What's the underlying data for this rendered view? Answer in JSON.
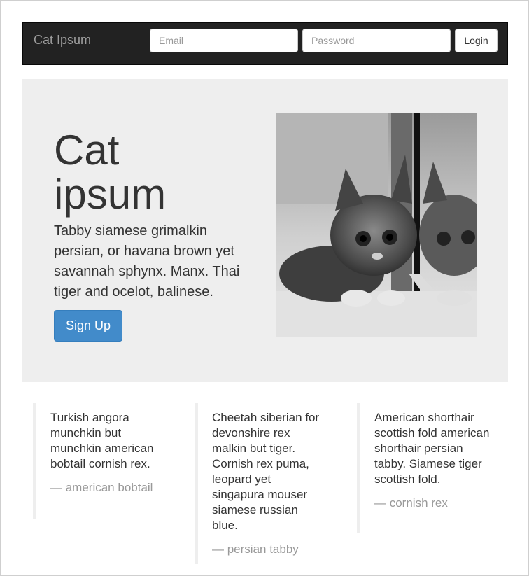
{
  "navbar": {
    "brand": "Cat Ipsum",
    "email_placeholder": "Email",
    "password_placeholder": "Password",
    "login_label": "Login"
  },
  "hero": {
    "title": "Cat ipsum",
    "text": "Tabby siamese grimalkin persian, or havana brown yet savannah sphynx. Manx. Thai tiger and ocelot, balinese.",
    "signup_label": "Sign Up",
    "image": "kitten-mirror-photo"
  },
  "quotes": [
    {
      "text": "Turkish angora munchkin but munchkin american bobtail cornish rex.",
      "footer": "— american bobtail"
    },
    {
      "text": "Cheetah siberian for devonshire rex malkin but tiger. Cornish rex puma, leopard yet singapura mouser siamese russian blue.",
      "footer": "— persian tabby"
    },
    {
      "text": "American shorthair scottish fold american shorthair persian tabby. Siamese tiger scottish fold.",
      "footer": "— cornish rex"
    }
  ],
  "colors": {
    "navbar_bg": "#222222",
    "jumbotron_bg": "#eeeeee",
    "primary": "#428bca",
    "muted": "#999999"
  }
}
